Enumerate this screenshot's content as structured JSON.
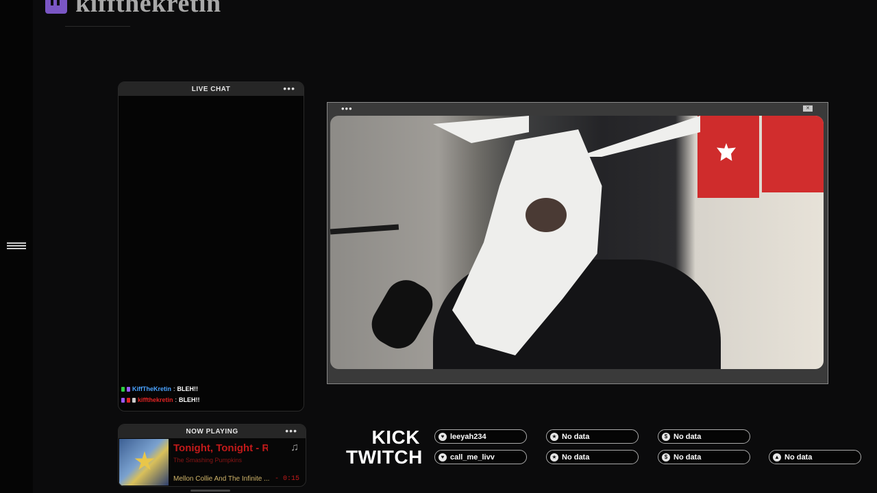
{
  "brand": {
    "name": "kiffthekretin"
  },
  "live_chat": {
    "title": "LIVE CHAT",
    "menu": "•••",
    "messages": [
      {
        "user": "KiffTheKretin",
        "user_color": "#4aa3ff",
        "separator": ":",
        "text": "BLEH!!",
        "badges": [
          "#2ecc40",
          "#9b59ff"
        ]
      },
      {
        "user": "kiffthekretin",
        "user_color": "#e02424",
        "separator": ":",
        "text": "BLEH!!",
        "badges": [
          "#9b59ff",
          "#e02424",
          "#cccccc"
        ]
      }
    ]
  },
  "now_playing": {
    "title": "NOW PLAYING",
    "menu": "•••",
    "track": "Tonight, Tonight - Re",
    "artist": "The Smashing Pumpkins",
    "album": "Mellon Collie And The Infinite ...",
    "time": "- 0:15",
    "icon": "music-note-icon"
  },
  "camera": {
    "menu": "•••",
    "close": "✕"
  },
  "platforms": {
    "kick_label": "KICK",
    "twitch_label": "TWITCH"
  },
  "stats": {
    "kick": [
      {
        "icon": "heart-icon",
        "glyph": "♥",
        "value": "leeyah234"
      },
      {
        "icon": "star-icon",
        "glyph": "★",
        "value": "No data"
      },
      {
        "icon": "dollar-icon",
        "glyph": "$",
        "value": "No data"
      }
    ],
    "twitch": [
      {
        "icon": "heart-icon",
        "glyph": "♥",
        "value": "call_me_livv"
      },
      {
        "icon": "star-icon",
        "glyph": "★",
        "value": "No data"
      },
      {
        "icon": "dollar-icon",
        "glyph": "$",
        "value": "No data"
      },
      {
        "icon": "triangle-icon",
        "glyph": "▲",
        "value": "No data"
      }
    ]
  }
}
